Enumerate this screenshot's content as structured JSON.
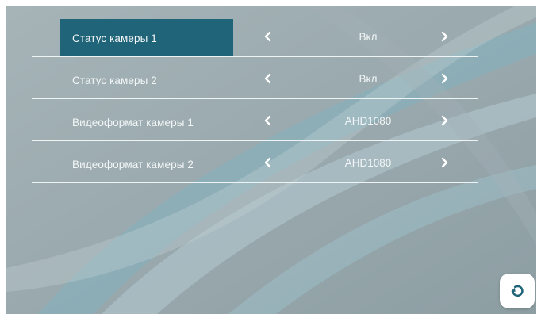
{
  "settings": [
    {
      "label": "Статус камеры 1",
      "value": "Вкл",
      "selected": true
    },
    {
      "label": "Статус камеры 2",
      "value": "Вкл",
      "selected": false
    },
    {
      "label": "Видеоформат камеры 1",
      "value": "AHD1080",
      "selected": false
    },
    {
      "label": "Видеоформат камеры 2",
      "value": "AHD1080",
      "selected": false
    }
  ],
  "icons": {
    "prev": "chevron-left-icon",
    "next": "chevron-right-icon",
    "back": "undo-arrow-icon"
  },
  "colors": {
    "selected_row": "#1f6478",
    "background": "#93a3a8",
    "text": "#f2f6f7"
  }
}
